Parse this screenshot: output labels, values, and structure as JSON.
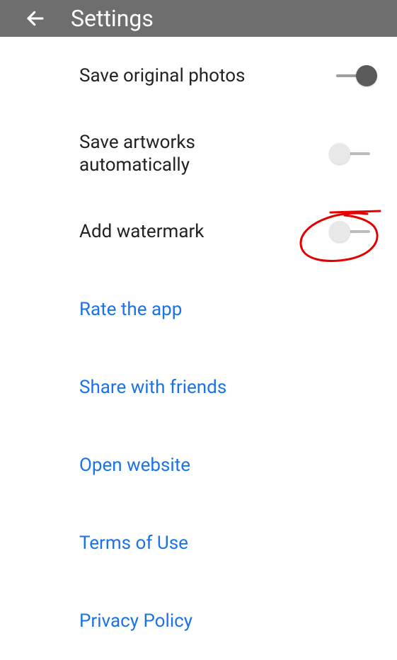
{
  "header": {
    "title": "Settings"
  },
  "rows": [
    {
      "label": "Save original photos",
      "type": "toggle",
      "state": "on"
    },
    {
      "label": "Save artworks automatically",
      "type": "toggle",
      "state": "off"
    },
    {
      "label": "Add watermark",
      "type": "toggle",
      "state": "off",
      "annotated": true
    },
    {
      "label": "Rate the app",
      "type": "link"
    },
    {
      "label": "Share with friends",
      "type": "link"
    },
    {
      "label": "Open website",
      "type": "link"
    },
    {
      "label": "Terms of Use",
      "type": "link"
    },
    {
      "label": "Privacy Policy",
      "type": "link"
    }
  ],
  "annotation_color": "#e50000"
}
